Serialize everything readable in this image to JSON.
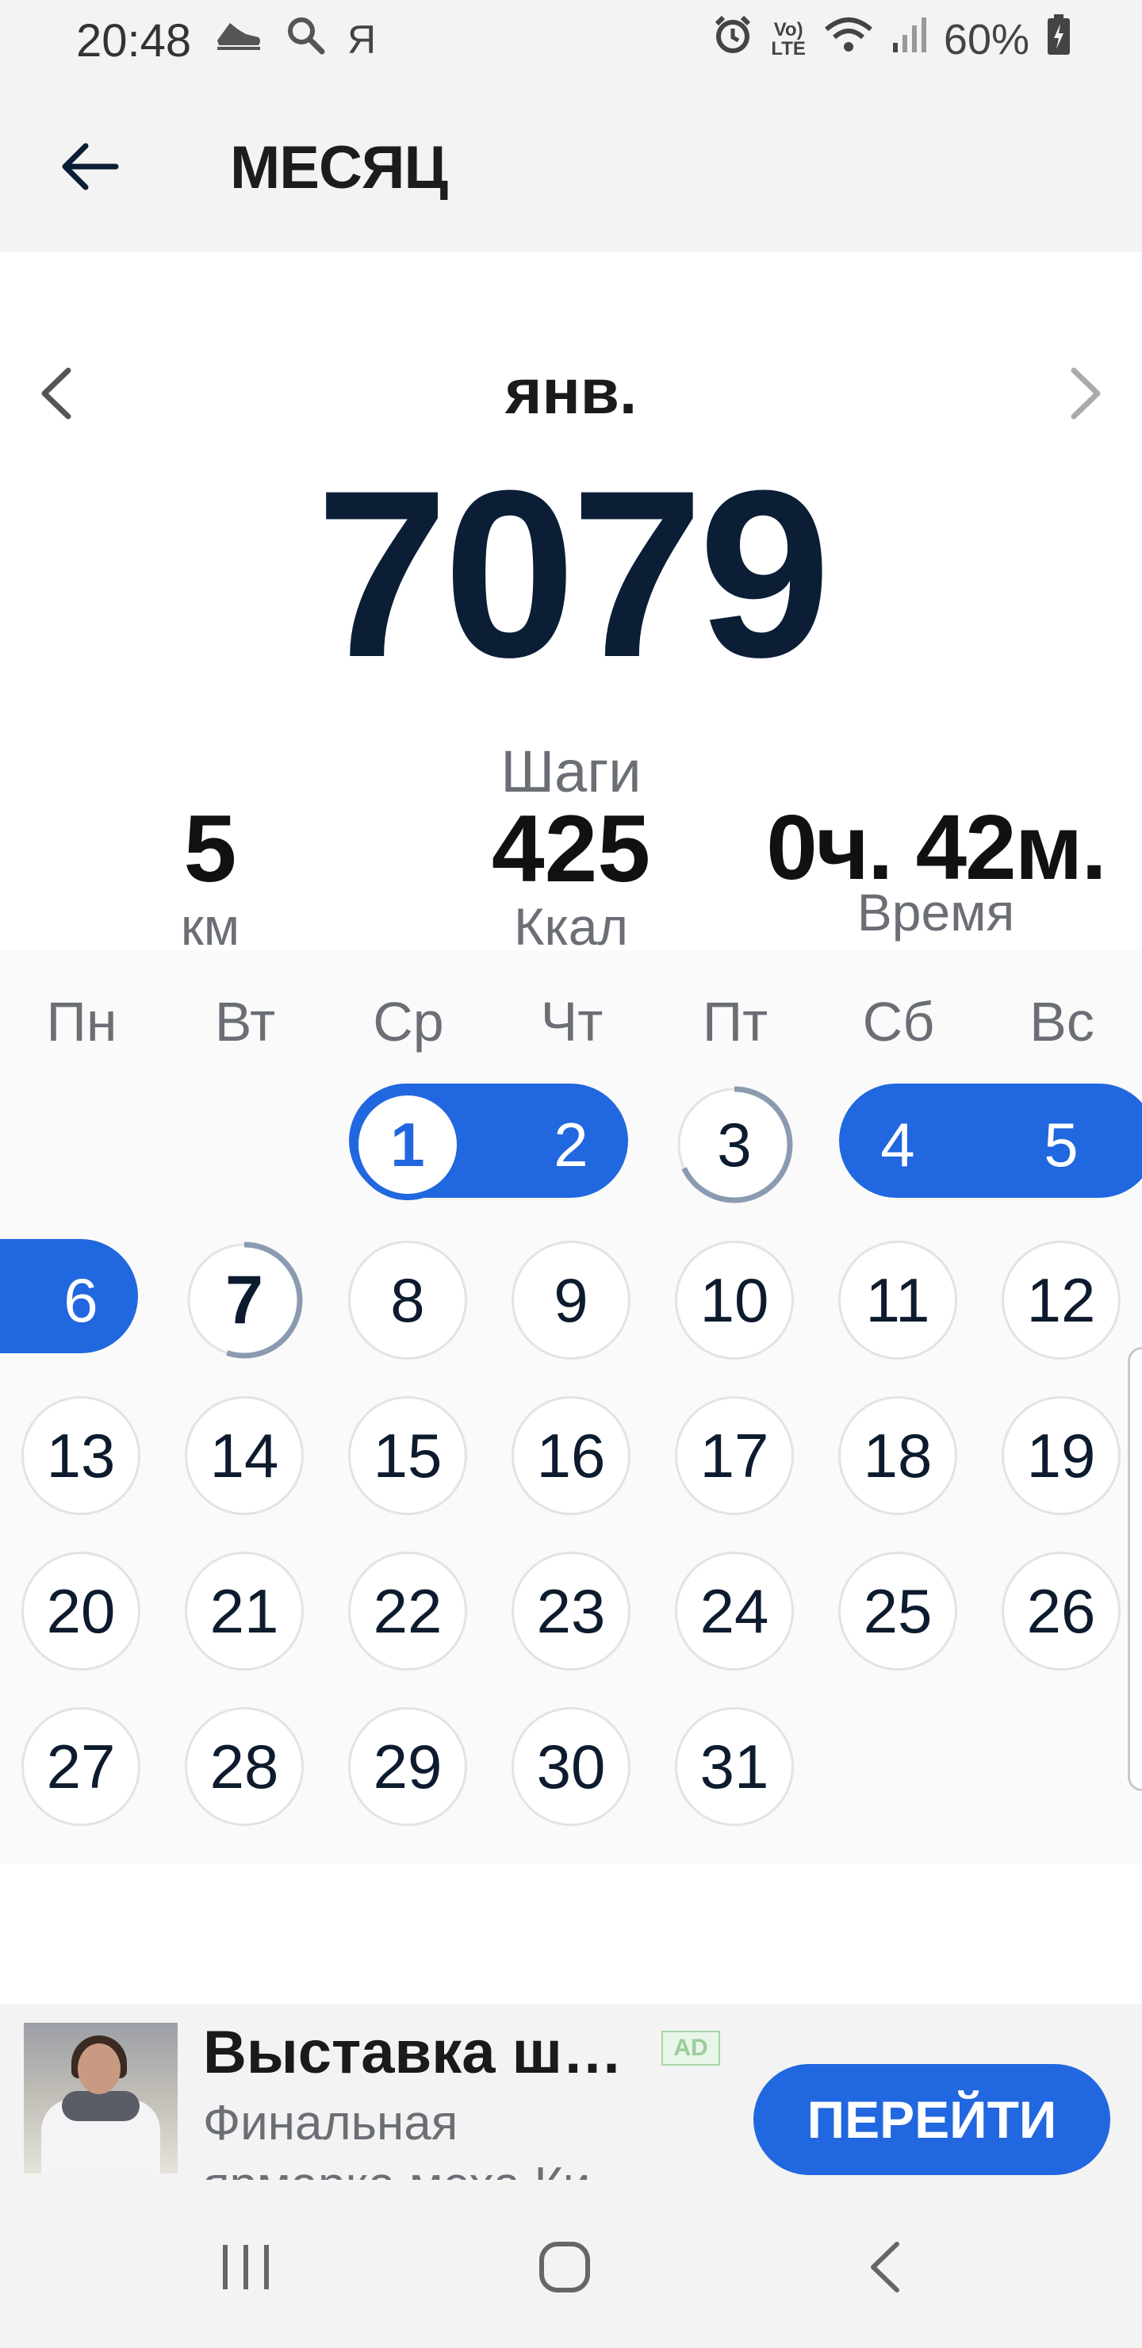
{
  "status_bar": {
    "time": "20:48",
    "keyboard_letter": "Я",
    "lte_top": "Vo)",
    "lte_bottom": "LTE",
    "battery": "60%"
  },
  "header": {
    "title": "МЕСЯЦ"
  },
  "summary": {
    "month": "янв.",
    "steps_value": "7079",
    "steps_label": "Шаги",
    "distance_value": "5",
    "distance_unit": "км",
    "calories_value": "425",
    "calories_unit": "Ккал",
    "time_value": "0ч. 42м.",
    "time_label": "Время"
  },
  "calendar": {
    "weekdays": [
      "Пн",
      "Вт",
      "Ср",
      "Чт",
      "Пт",
      "Сб",
      "Вс"
    ],
    "days": [
      "1",
      "2",
      "3",
      "4",
      "5",
      "6",
      "7",
      "8",
      "9",
      "10",
      "11",
      "12",
      "13",
      "14",
      "15",
      "16",
      "17",
      "18",
      "19",
      "20",
      "21",
      "22",
      "23",
      "24",
      "25",
      "26",
      "27",
      "28",
      "29",
      "30",
      "31"
    ],
    "goal_reached_days": [
      "1",
      "2",
      "4",
      "5",
      "6"
    ],
    "partial_progress_days": [
      "3",
      "7"
    ],
    "today": "7"
  },
  "ad": {
    "title": "Выставка ш…",
    "badge": "AD",
    "description": "Финальная ярмарка меха Ки",
    "cta": "ПЕРЕЙТИ"
  },
  "colors": {
    "accent": "#2167df",
    "steps": "#0b1e36",
    "progress_ring": "#8a9bb0"
  }
}
